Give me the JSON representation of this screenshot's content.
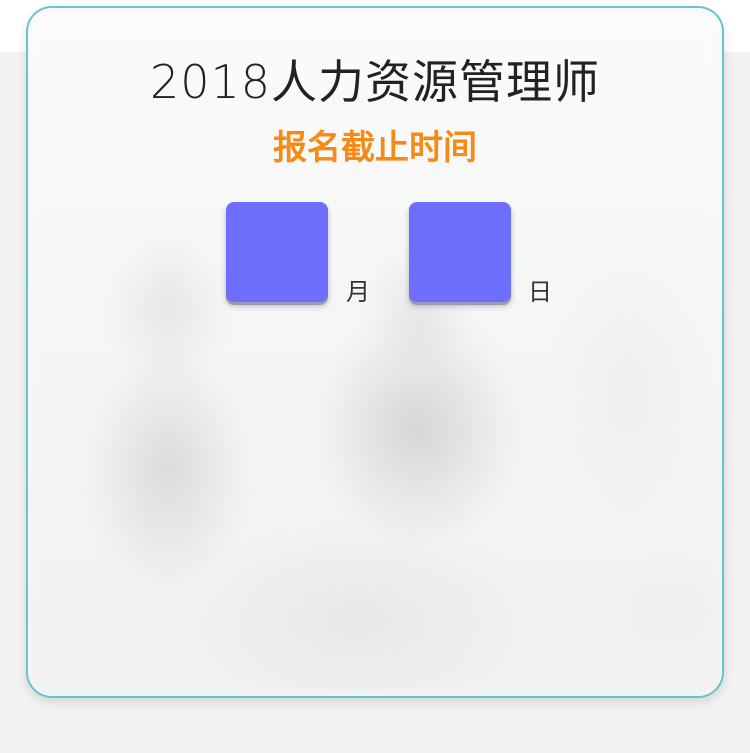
{
  "poster": {
    "title": "2018人力资源管理师",
    "subtitle": "报名截止时间",
    "month_unit": "月",
    "day_unit": "日",
    "month_value": "",
    "day_value": "",
    "accent_color": "#f58a14",
    "box_color": "#6d6ffc",
    "border_color": "#62c6cc"
  }
}
